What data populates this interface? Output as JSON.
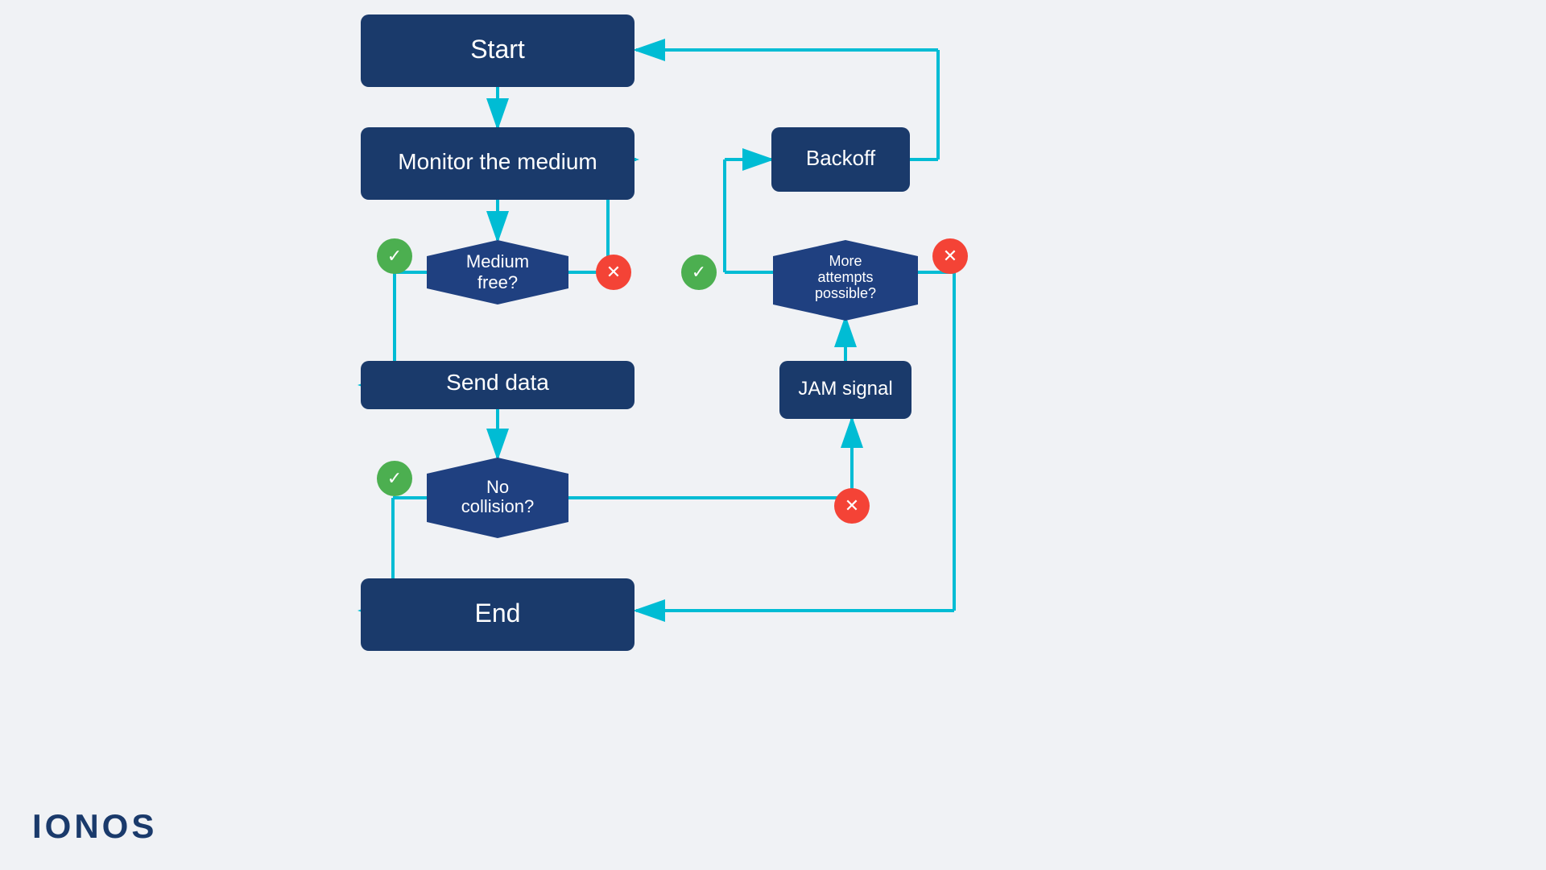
{
  "logo": "IONOS",
  "colors": {
    "box_fill": "#1a3a6b",
    "box_fill_dark": "#163060",
    "arrow": "#00bcd4",
    "green_circle": "#4caf50",
    "red_circle": "#f44336",
    "white": "#ffffff",
    "bg": "#f0f2f5"
  },
  "nodes": {
    "start": {
      "label": "Start"
    },
    "monitor": {
      "label": "Monitor the medium"
    },
    "medium_free": {
      "label": "Medium free?"
    },
    "send_data": {
      "label": "Send data"
    },
    "no_collision": {
      "label": "No collision?"
    },
    "end": {
      "label": "End"
    },
    "backoff": {
      "label": "Backoff"
    },
    "more_attempts": {
      "label": "More attempts possible?"
    },
    "jam_signal": {
      "label": "JAM signal"
    }
  }
}
